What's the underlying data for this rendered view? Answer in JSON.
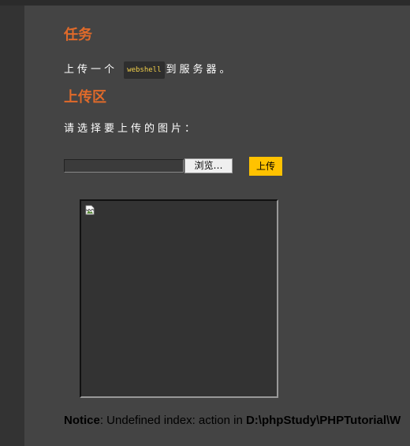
{
  "task": {
    "title": "任务",
    "desc_before": "上传一个",
    "code": "webshell",
    "desc_after": "到服务器。"
  },
  "upload": {
    "title": "上传区",
    "prompt": "请选择要上传的图片：",
    "browse_label": "浏览…",
    "submit_label": "上传"
  },
  "notice": {
    "label": "Notice",
    "message": ": Undefined index: action in ",
    "path": "D:\\phpStudy\\PHPTutorial\\W"
  },
  "colors": {
    "accent_title": "#e06a2a",
    "upload_button": "#ffc200",
    "code_text": "#f2d04b"
  },
  "icons": {
    "preview": "broken-image-icon"
  }
}
